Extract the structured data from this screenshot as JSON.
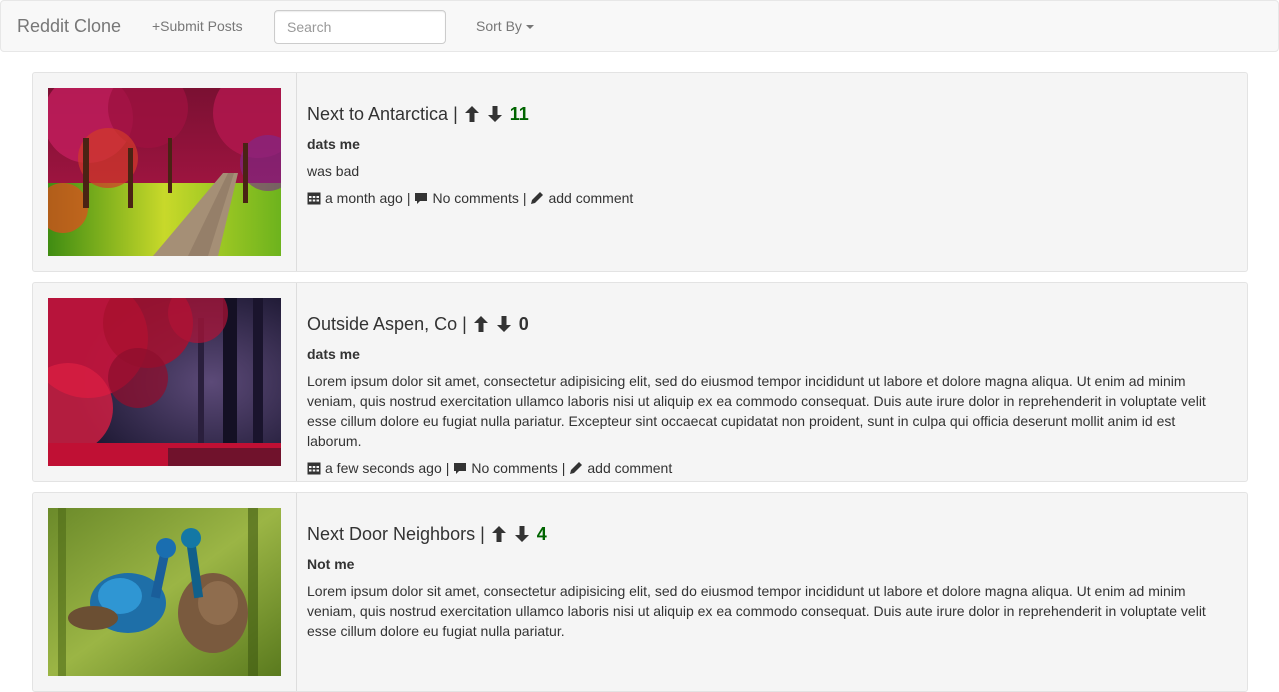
{
  "navbar": {
    "brand": "Reddit Clone",
    "submit_link": "+Submit Posts",
    "search_placeholder": "Search",
    "sort_label": "Sort By"
  },
  "posts": [
    {
      "title": "Next to Antarctica",
      "score": "11",
      "score_color": "#006400",
      "author": "dats me",
      "body": "was bad",
      "time": "a month ago",
      "comments": "No comments",
      "add_comment": "add comment",
      "image": "forest-road-photo"
    },
    {
      "title": "Outside Aspen, Co",
      "score": "0",
      "score_color": "#333333",
      "author": "dats me",
      "body": "Lorem ipsum dolor sit amet, consectetur adipisicing elit, sed do eiusmod tempor incididunt ut labore et dolore magna aliqua. Ut enim ad minim veniam, quis nostrud exercitation ullamco laboris nisi ut aliquip ex ea commodo consequat. Duis aute irure dolor in reprehenderit in voluptate velit esse cillum dolore eu fugiat nulla pariatur. Excepteur sint occaecat cupidatat non proident, sunt in culpa qui officia deserunt mollit anim id est laborum.",
      "time": "a few seconds ago",
      "comments": "No comments",
      "add_comment": "add comment",
      "image": "red-forest-photo"
    },
    {
      "title": "Next Door Neighbors",
      "score": "4",
      "score_color": "#006400",
      "author": "Not me",
      "body": "Lorem ipsum dolor sit amet, consectetur adipisicing elit, sed do eiusmod tempor incididunt ut labore et dolore magna aliqua. Ut enim ad minim veniam, quis nostrud exercitation ullamco laboris nisi ut aliquip ex ea commodo consequat. Duis aute irure dolor in reprehenderit in voluptate velit esse cillum dolore eu fugiat nulla pariatur.",
      "time": "",
      "comments": "",
      "add_comment": "",
      "image": "peacocks-photo"
    }
  ],
  "icons": {
    "upvote": "arrow-up-icon",
    "downvote": "arrow-down-icon",
    "date": "calendar-icon",
    "comments": "comment-icon",
    "add": "pencil-icon"
  }
}
